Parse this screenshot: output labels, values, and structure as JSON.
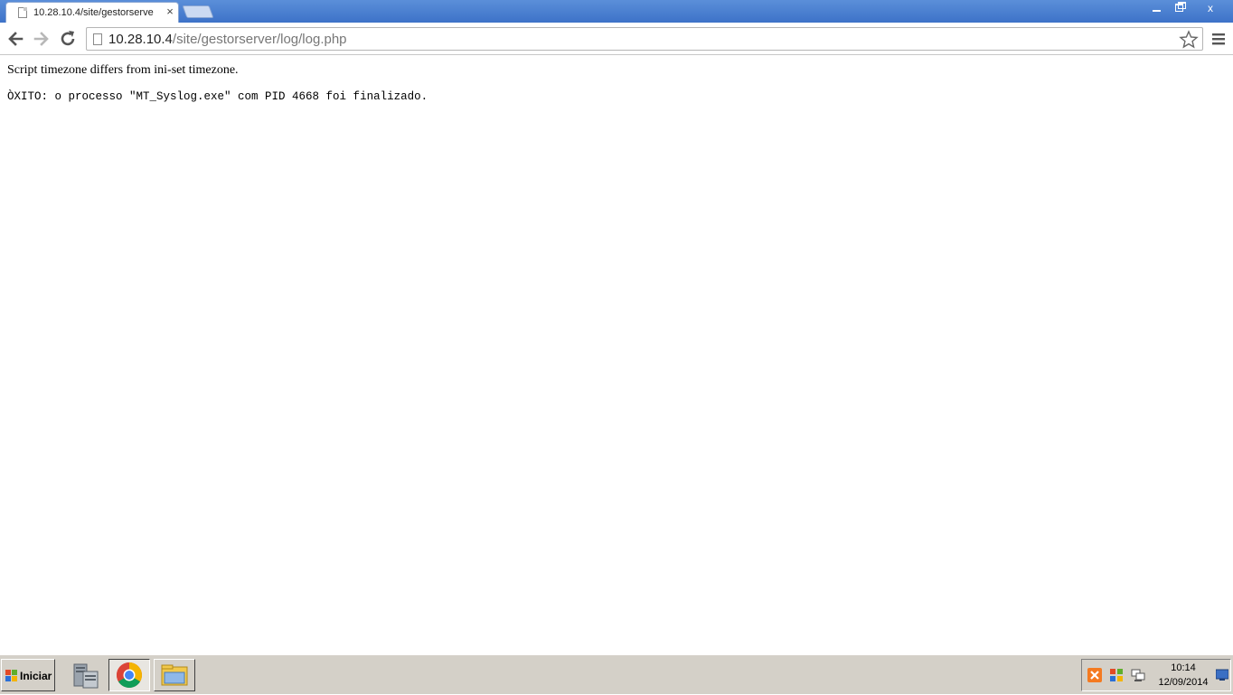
{
  "browser": {
    "tab_title": "10.28.10.4/site/gestorserve",
    "tab_close": "×",
    "url_host": "10.28.10.4",
    "url_path": "/site/gestorserver/log/log.php"
  },
  "window_controls": {
    "close": "x"
  },
  "page": {
    "line1": "Script timezone differs from ini-set timezone.",
    "line2": "ÒXITO: o processo \"MT_Syslog.exe\" com PID 4668 foi finalizado."
  },
  "taskbar": {
    "start_label": "Iniciar",
    "clock_time": "10:14",
    "clock_date": "12/09/2014"
  },
  "colors": {
    "titlebar": "#3d72c8",
    "taskbar": "#d4d0c8",
    "xampp_orange": "#f47a20"
  }
}
